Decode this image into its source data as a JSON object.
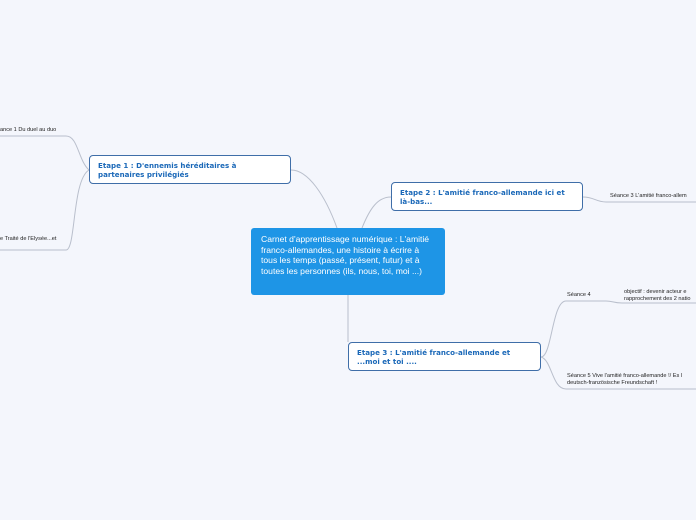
{
  "central": {
    "text": "Carnet d'apprentissage numérique : L'amitié franco-allemandes, une histoire à écrire à tous les temps (passé, présent, futur) et à toutes les personnes (ils, nous, toi, moi ...)"
  },
  "etape1": {
    "title": "Etape 1 : D'ennemis héréditaires à partenaires privilégiés",
    "seance1": "ance 1 Du duel au duo",
    "seance2": "e Traité de l'Elysée...et"
  },
  "etape2": {
    "title": "Etape 2 : L'amitié franco-allemande ici et là-bas...",
    "seance3": "Séance 3 L'amitié franco-allem"
  },
  "etape3": {
    "title": "Etape 3 : L'amitié franco-allemande et ...moi et toi ....",
    "seance4": "Séance 4",
    "objectif_line1": "objectif : devenir acteur e",
    "objectif_line2": "rapprochement des 2 natio",
    "seance5_line1": "Séance 5 Vive l'amitié franco-allemande !/ Es l",
    "seance5_line2": "deutsch-französische Freundschaft !"
  },
  "colors": {
    "background": "#f4f6fc",
    "central": "#1e95e6",
    "main_border": "#3f6ea8",
    "main_text": "#1a68b8",
    "connector": "#b9bfcc"
  }
}
